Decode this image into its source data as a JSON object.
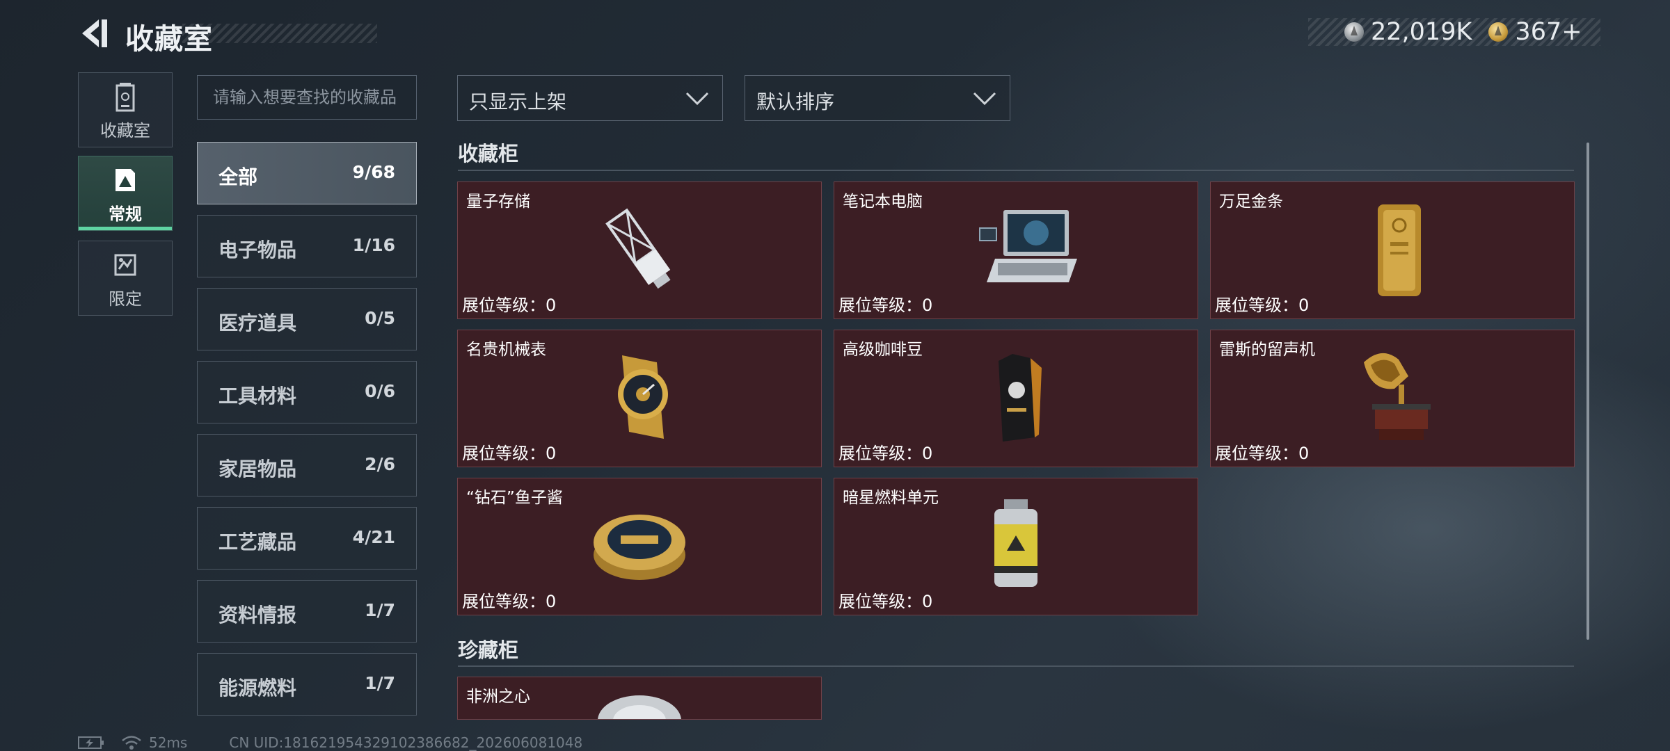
{
  "header": {
    "title": "收藏室",
    "currency": [
      {
        "icon": "silver-coin-icon",
        "value": "22,019K"
      },
      {
        "icon": "gold-coin-icon",
        "value": "367+"
      }
    ]
  },
  "left_nav": [
    {
      "label": "收藏室",
      "icon": "vault-icon",
      "active": false
    },
    {
      "label": "常规",
      "icon": "picture-icon",
      "active": true
    },
    {
      "label": "限定",
      "icon": "limited-icon",
      "active": false
    }
  ],
  "search": {
    "placeholder": "请输入想要查找的收藏品"
  },
  "categories": [
    {
      "name": "全部",
      "count": "9/68",
      "active": true
    },
    {
      "name": "电子物品",
      "count": "1/16"
    },
    {
      "name": "医疗道具",
      "count": "0/5"
    },
    {
      "name": "工具材料",
      "count": "0/6"
    },
    {
      "name": "家居物品",
      "count": "2/6"
    },
    {
      "name": "工艺藏品",
      "count": "4/21"
    },
    {
      "name": "资料情报",
      "count": "1/7"
    },
    {
      "name": "能源燃料",
      "count": "1/7"
    }
  ],
  "filters": {
    "show": "只显示上架",
    "sort": "默认排序"
  },
  "sections": [
    {
      "title": "收藏柜",
      "items": [
        {
          "name": "量子存储",
          "level": "展位等级：0",
          "icon": "usb-drive-icon"
        },
        {
          "name": "笔记本电脑",
          "level": "展位等级：0",
          "icon": "laptop-icon"
        },
        {
          "name": "万足金条",
          "level": "展位等级：0",
          "icon": "gold-bar-icon"
        },
        {
          "name": "名贵机械表",
          "level": "展位等级：0",
          "icon": "watch-icon"
        },
        {
          "name": "高级咖啡豆",
          "level": "展位等级：0",
          "icon": "coffee-bag-icon"
        },
        {
          "name": "雷斯的留声机",
          "level": "展位等级：0",
          "icon": "gramophone-icon"
        },
        {
          "name": "“钻石”鱼子酱",
          "level": "展位等级：0",
          "icon": "caviar-tin-icon"
        },
        {
          "name": "暗星燃料单元",
          "level": "展位等级：0",
          "icon": "fuel-cell-icon"
        }
      ]
    },
    {
      "title": "珍藏柜",
      "items": [
        {
          "name": "非洲之心",
          "icon": "diamond-icon"
        }
      ]
    }
  ],
  "footer": {
    "ping": "52ms",
    "uid": "CN UID:1816219543291023866​82_202606081048"
  }
}
